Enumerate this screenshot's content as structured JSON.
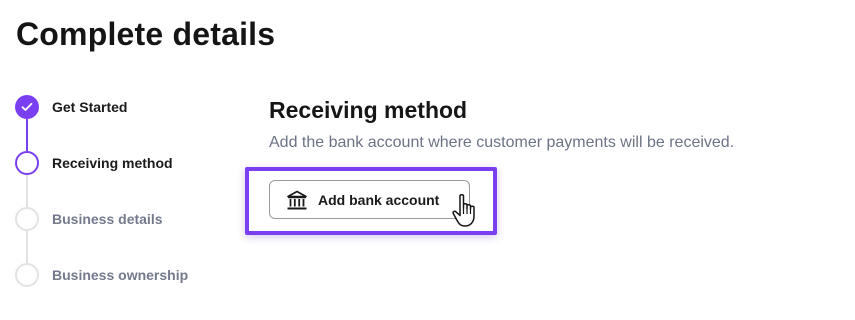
{
  "page": {
    "title": "Complete details"
  },
  "stepper": {
    "steps": [
      {
        "label": "Get Started",
        "status": "completed"
      },
      {
        "label": "Receiving method",
        "status": "active"
      },
      {
        "label": "Business details",
        "status": "pending"
      },
      {
        "label": "Business ownership",
        "status": "pending"
      }
    ]
  },
  "section": {
    "title": "Receiving method",
    "description": "Add the bank account where customer payments will be received."
  },
  "button": {
    "label": "Add bank account",
    "icon": "bank-icon"
  },
  "colors": {
    "accent": "#7b3ff2",
    "muted_text": "#737a8c",
    "pending_border": "#e3e3e6"
  }
}
